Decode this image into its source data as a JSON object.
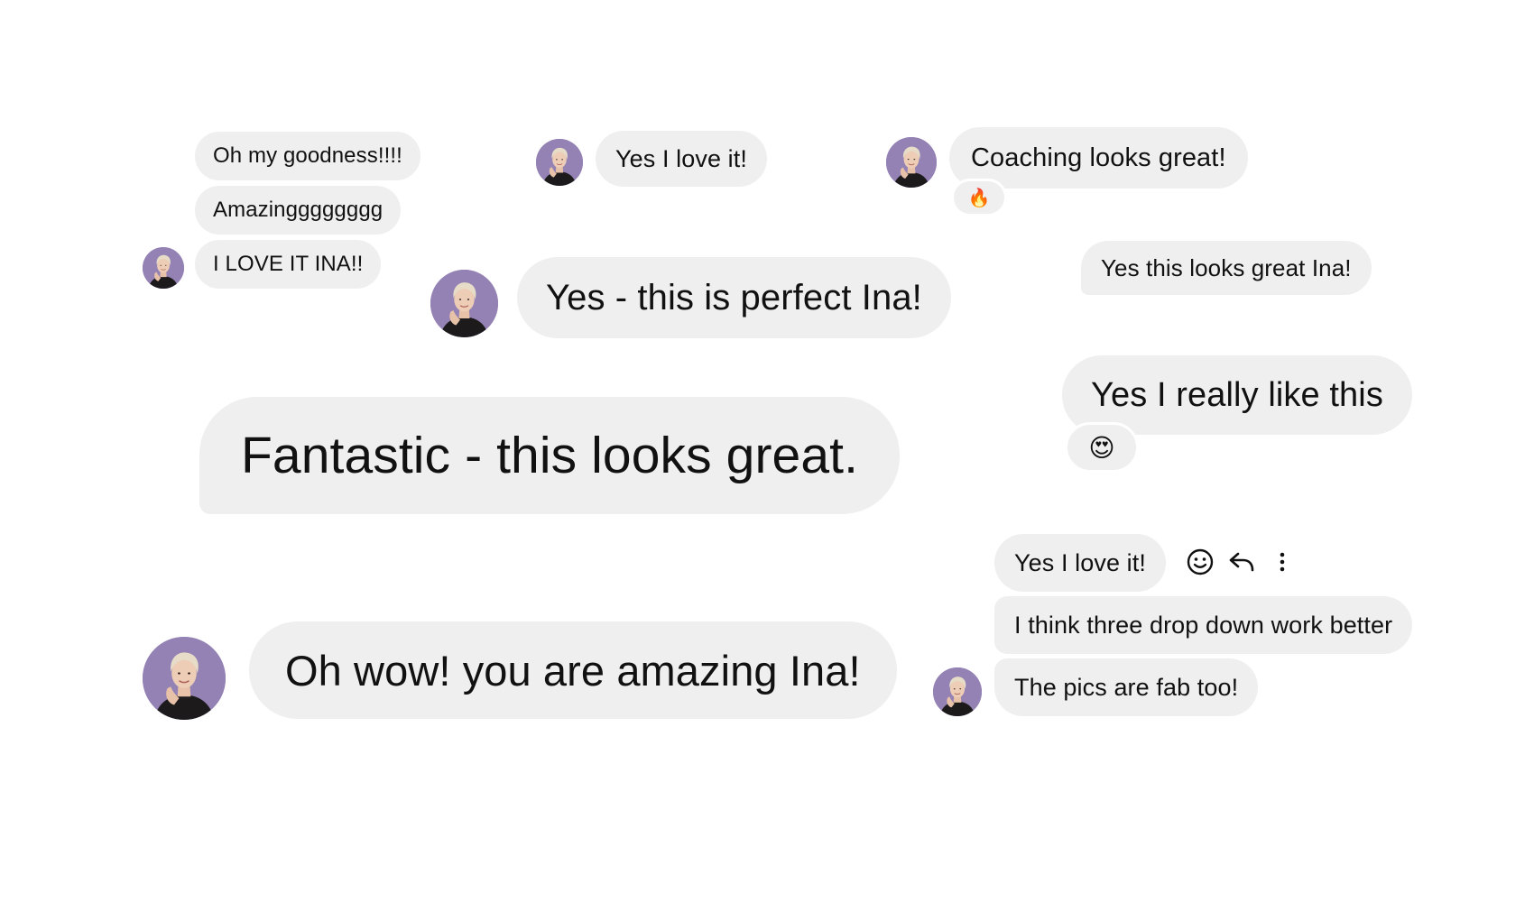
{
  "messages": {
    "m1": "Oh my goodness!!!!",
    "m2": "Amazingggggggg",
    "m3": "I LOVE IT INA!!",
    "m4": "Yes I love it!",
    "m5": "Coaching looks great!",
    "m6": "Yes - this is perfect Ina!",
    "m7": "Yes this looks great Ina!",
    "m8": "Yes I really like this",
    "m9": "Fantastic - this looks great.",
    "m10": "Yes I love it!",
    "m11": "I think three drop down work better",
    "m12": "The pics are fab too!",
    "m13": "Oh wow! you are amazing Ina!"
  },
  "reactions": {
    "coaching": "🔥",
    "really_like": "😍"
  },
  "icons": {
    "react": "smiley-icon",
    "reply": "reply-arrow-icon",
    "more": "more-vertical-icon"
  },
  "colors": {
    "bubble_bg": "#efefef",
    "text": "#111111",
    "avatar_bg": "#8f7eb0",
    "page_bg": "#ffffff"
  }
}
